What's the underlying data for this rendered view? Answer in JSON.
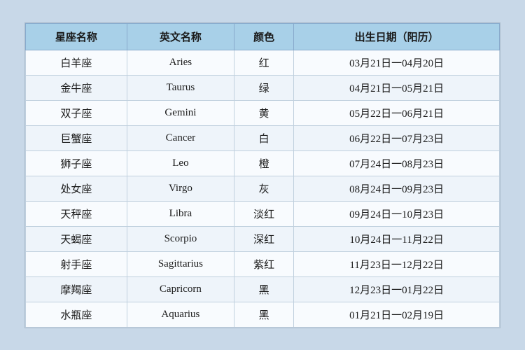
{
  "table": {
    "headers": [
      "星座名称",
      "英文名称",
      "颜色",
      "出生日期（阳历）"
    ],
    "rows": [
      {
        "chinese": "白羊座",
        "english": "Aries",
        "color": "红",
        "dates": "03月21日一04月20日"
      },
      {
        "chinese": "金牛座",
        "english": "Taurus",
        "color": "绿",
        "dates": "04月21日一05月21日"
      },
      {
        "chinese": "双子座",
        "english": "Gemini",
        "color": "黄",
        "dates": "05月22日一06月21日"
      },
      {
        "chinese": "巨蟹座",
        "english": "Cancer",
        "color": "白",
        "dates": "06月22日一07月23日"
      },
      {
        "chinese": "狮子座",
        "english": "Leo",
        "color": "橙",
        "dates": "07月24日一08月23日"
      },
      {
        "chinese": "处女座",
        "english": "Virgo",
        "color": "灰",
        "dates": "08月24日一09月23日"
      },
      {
        "chinese": "天秤座",
        "english": "Libra",
        "color": "淡红",
        "dates": "09月24日一10月23日"
      },
      {
        "chinese": "天蝎座",
        "english": "Scorpio",
        "color": "深红",
        "dates": "10月24日一11月22日"
      },
      {
        "chinese": "射手座",
        "english": "Sagittarius",
        "color": "紫红",
        "dates": "11月23日一12月22日"
      },
      {
        "chinese": "摩羯座",
        "english": "Capricorn",
        "color": "黑",
        "dates": "12月23日一01月22日"
      },
      {
        "chinese": "水瓶座",
        "english": "Aquarius",
        "color": "黑",
        "dates": "01月21日一02月19日"
      }
    ]
  }
}
